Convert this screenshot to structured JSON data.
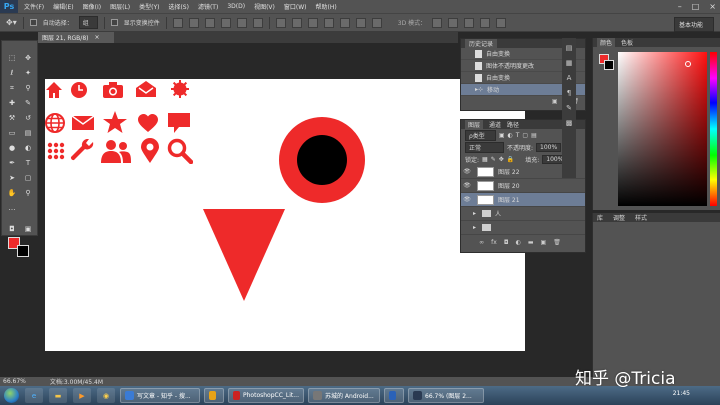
{
  "app": {
    "logo": "Ps"
  },
  "menu": [
    "文件(F)",
    "编辑(E)",
    "图像(I)",
    "图层(L)",
    "类型(Y)",
    "选择(S)",
    "滤镜(T)",
    "3D(D)",
    "视图(V)",
    "窗口(W)",
    "帮助(H)"
  ],
  "window_controls": [
    "–",
    "□",
    "×"
  ],
  "options_bar": {
    "auto_select_label": "自动选择：",
    "auto_select_value": "组",
    "show_transform_label": "显示变换控件",
    "mode_3d_label": "3D 模式：",
    "workspace": "基本功能"
  },
  "document_tab": {
    "title": "图层 21, RGB/8)",
    "close": "×"
  },
  "canvas": {
    "colors": {
      "red": "#ee2a2a",
      "black": "#000000",
      "white": "#ffffff"
    },
    "icons": [
      "home-icon",
      "clock-icon",
      "camera-icon",
      "mail-open-icon",
      "gear-icon",
      "globe-icon",
      "envelope-icon",
      "star-icon",
      "heart-icon",
      "speech-bubble-icon",
      "dots-grid-icon",
      "wrench-icon",
      "users-icon",
      "map-pin-icon",
      "magnifier-icon"
    ]
  },
  "history_panel": {
    "tabs": [
      "历史记录"
    ],
    "items": [
      {
        "label": "自由变换",
        "selected": false
      },
      {
        "label": "图体不透明度更改",
        "selected": false
      },
      {
        "label": "自由变换",
        "selected": false
      },
      {
        "label": "移动",
        "selected": true
      }
    ]
  },
  "layers_panel": {
    "tabs": [
      "图层",
      "通道",
      "路径"
    ],
    "kind_filter": "ρ类型",
    "blend_mode": "正常",
    "opacity_label": "不透明度:",
    "opacity_value": "100%",
    "lock_label": "锁定:",
    "fill_label": "填充:",
    "fill_value": "100%",
    "layers": [
      {
        "name": "图层 22",
        "selected": false,
        "type": "layer"
      },
      {
        "name": "图层 20",
        "selected": false,
        "type": "layer"
      },
      {
        "name": "图层 21",
        "selected": true,
        "type": "layer"
      },
      {
        "name": "人",
        "selected": false,
        "type": "group"
      },
      {
        "name": "",
        "selected": false,
        "type": "group"
      }
    ]
  },
  "color_panel": {
    "tabs": [
      "颜色",
      "色板"
    ]
  },
  "adjust_panel": {
    "tabs": [
      "库",
      "调整",
      "样式"
    ]
  },
  "status_bar": {
    "zoom": "66.67%",
    "doc_info": "文档:3.00M/45.4M"
  },
  "taskbar": {
    "tasks": [
      {
        "label": "写文章 - 知乎 - 搜...",
        "color": "#3a7bd5"
      },
      {
        "label": "",
        "color": "#e8a317"
      },
      {
        "label": "PhotoshopCC_Lit...",
        "color": "#c22"
      },
      {
        "label": "苏城的 Android...",
        "color": "#777"
      },
      {
        "label": "",
        "color": "#2a62b8"
      },
      {
        "label": "66.7% (图层 2...",
        "color": "#2a3a52"
      }
    ],
    "clock": "21:45"
  },
  "watermark": "知乎 @Tricia"
}
